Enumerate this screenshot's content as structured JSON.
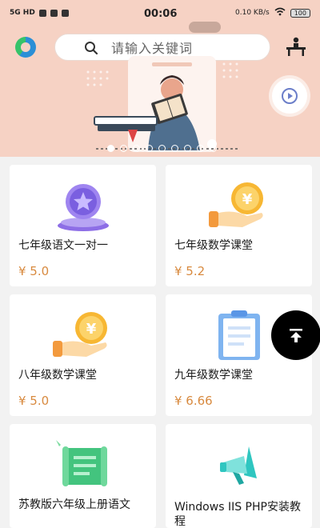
{
  "status_bar": {
    "time": "00:06",
    "left_text": "5G HD",
    "speed": "0.10 KB/s",
    "battery": "100"
  },
  "search": {
    "placeholder": "请输入关键词"
  },
  "banner": {
    "slide_count": 9,
    "active_slide": 0
  },
  "courses": [
    {
      "title": "七年级语文一对一",
      "price": "¥ 5.0",
      "icon": "medal-star-icon"
    },
    {
      "title": "七年级数学课堂",
      "price": "¥ 5.2",
      "icon": "coin-hand-icon"
    },
    {
      "title": "八年级数学课堂",
      "price": "¥ 5.0",
      "icon": "coin-hand-icon"
    },
    {
      "title": "九年级数学课堂",
      "price": "¥ 6.66",
      "icon": "clipboard-icon"
    },
    {
      "title": "苏教版六年级上册语文",
      "price": "",
      "icon": "scroll-icon"
    },
    {
      "title": "Windows IIS PHP安装教程",
      "price": "",
      "icon": "megaphone-icon"
    }
  ],
  "colors": {
    "banner_bg": "#f6d2c4",
    "price": "#d88a3f",
    "page_bg": "#f2f2f2"
  }
}
